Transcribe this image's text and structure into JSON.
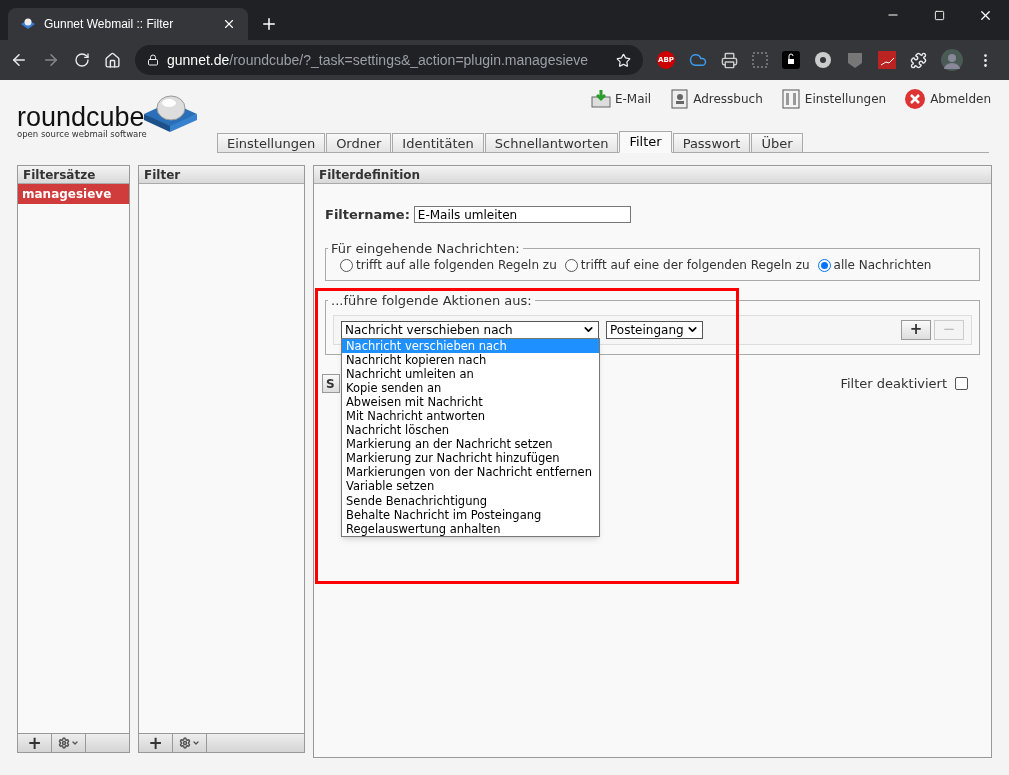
{
  "browser": {
    "tab_title": "Gunnet Webmail :: Filter",
    "url_host": "gunnet.de",
    "url_path": "/roundcube/?_task=settings&_action=plugin.managesieve",
    "extension_label": "ABP"
  },
  "logo": {
    "name": "roundcube",
    "tagline": "open source webmail software"
  },
  "topnav": [
    {
      "label": "E-Mail",
      "kind": "mail"
    },
    {
      "label": "Adressbuch",
      "kind": "contacts"
    },
    {
      "label": "Einstellungen",
      "kind": "settings"
    },
    {
      "label": "Abmelden",
      "kind": "logout"
    }
  ],
  "tabs": [
    {
      "label": "Einstellungen",
      "selected": false
    },
    {
      "label": "Ordner",
      "selected": false
    },
    {
      "label": "Identitäten",
      "selected": false
    },
    {
      "label": "Schnellantworten",
      "selected": false
    },
    {
      "label": "Filter",
      "selected": true
    },
    {
      "label": "Passwort",
      "selected": false
    },
    {
      "label": "Über",
      "selected": false
    }
  ],
  "filtersets": {
    "title": "Filtersätze",
    "items": [
      {
        "label": "managesieve",
        "selected": true
      }
    ]
  },
  "filters": {
    "title": "Filter"
  },
  "definition": {
    "title": "Filterdefinition",
    "name_label": "Filtername:",
    "name_value": "E-Mails umleiten",
    "incoming": {
      "legend": "Für eingehende Nachrichten:",
      "options": [
        {
          "label": "trifft auf alle folgenden Regeln zu",
          "selected": false
        },
        {
          "label": "trifft auf eine der folgenden Regeln zu",
          "selected": false
        },
        {
          "label": "alle Nachrichten",
          "selected": true
        }
      ]
    },
    "actions": {
      "legend": "...führe folgende Aktionen aus:",
      "action_value": "Nachricht verschieben nach",
      "folder_value": "Posteingang",
      "add_label": "+",
      "remove_label": "−",
      "dropdown": [
        {
          "label": "Nachricht verschieben nach",
          "selected": true
        },
        {
          "label": "Nachricht kopieren nach",
          "selected": false
        },
        {
          "label": "Nachricht umleiten an",
          "selected": false
        },
        {
          "label": "Kopie senden an",
          "selected": false
        },
        {
          "label": "Abweisen mit Nachricht",
          "selected": false
        },
        {
          "label": "Mit Nachricht antworten",
          "selected": false
        },
        {
          "label": "Nachricht löschen",
          "selected": false
        },
        {
          "label": "Markierung an der Nachricht setzen",
          "selected": false
        },
        {
          "label": "Markierung zur Nachricht hinzufügen",
          "selected": false
        },
        {
          "label": "Markierungen von der Nachricht entfernen",
          "selected": false
        },
        {
          "label": "Variable setzen",
          "selected": false
        },
        {
          "label": "Sende Benachrichtigung",
          "selected": false
        },
        {
          "label": "Behalte Nachricht im Posteingang",
          "selected": false
        },
        {
          "label": "Regelauswertung anhalten",
          "selected": false
        }
      ]
    },
    "save_label": "S",
    "disabled_label": "Filter deaktiviert",
    "disabled_checked": false
  },
  "footer_add_label": "+"
}
